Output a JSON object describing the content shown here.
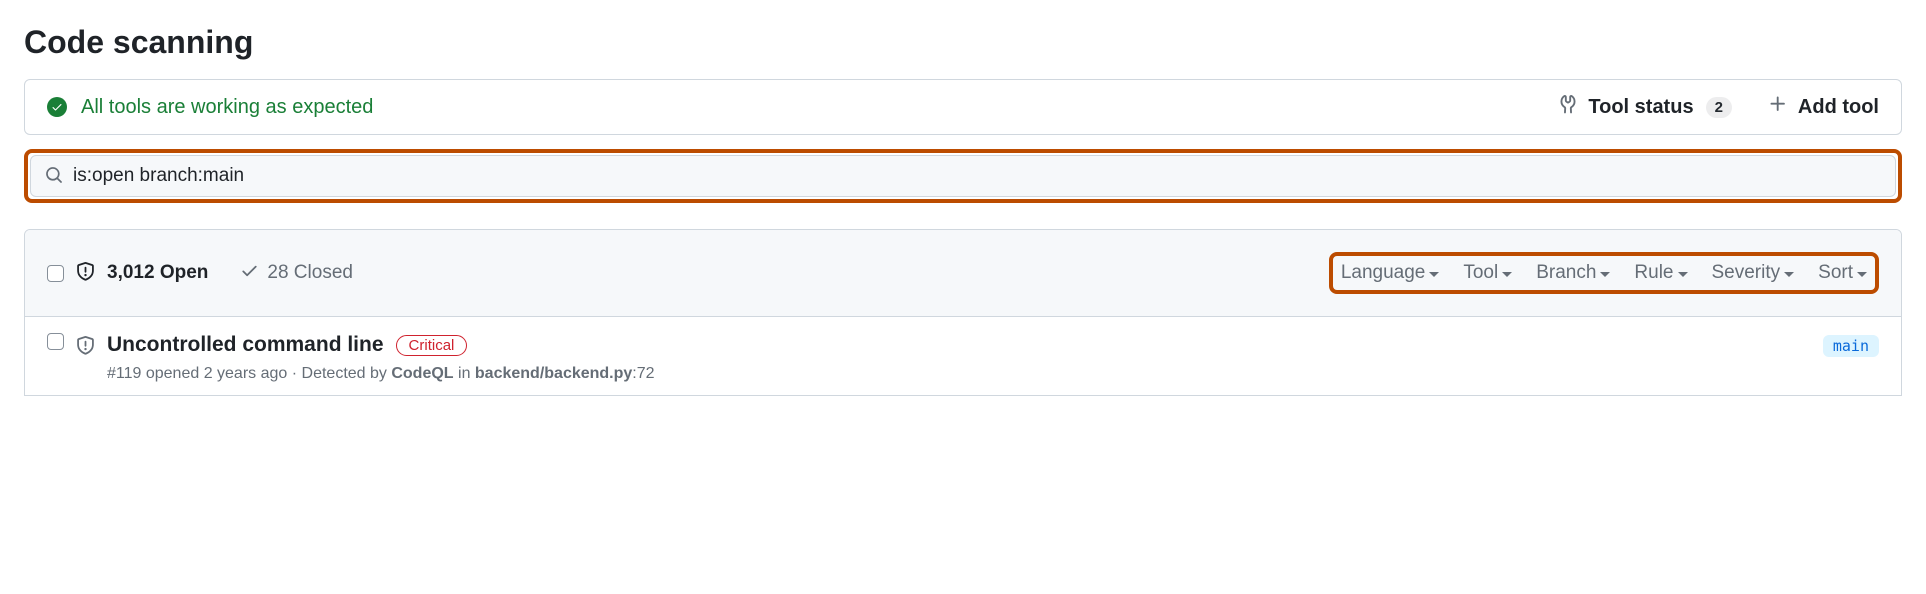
{
  "page": {
    "title": "Code scanning"
  },
  "status": {
    "message": "All tools are working as expected",
    "tool_status_label": "Tool status",
    "tool_count": "2",
    "add_tool_label": "Add tool"
  },
  "search": {
    "query": "is:open branch:main"
  },
  "list_header": {
    "open_label": "3,012 Open",
    "closed_label": "28 Closed",
    "filters": [
      {
        "label": "Language"
      },
      {
        "label": "Tool"
      },
      {
        "label": "Branch"
      },
      {
        "label": "Rule"
      },
      {
        "label": "Severity"
      },
      {
        "label": "Sort"
      }
    ]
  },
  "alert": {
    "title": "Uncontrolled command line",
    "severity": "Critical",
    "meta_prefix": "#119 opened 2 years ago · Detected by ",
    "detector": "CodeQL",
    "meta_in": " in ",
    "path": "backend/backend.py",
    "line_suffix": ":72",
    "branch": "main"
  }
}
